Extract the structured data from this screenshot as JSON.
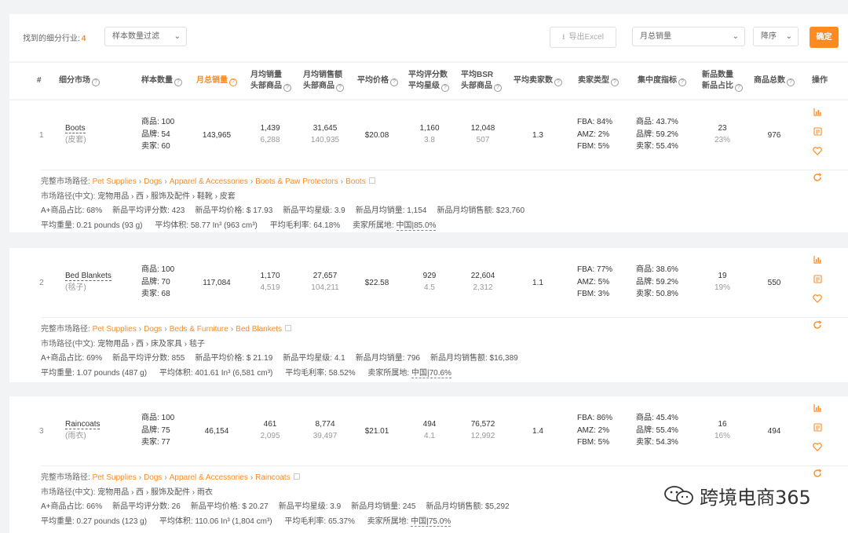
{
  "toolbar": {
    "found_label": "找到的细分行业:",
    "found_count": "4",
    "filter_placeholder": "样本数量过滤",
    "export_label": "导出Excel",
    "metric_value": "月总销量",
    "order_value": "降序",
    "confirm_label": "确定"
  },
  "header": {
    "idx": "#",
    "market": "细分市场",
    "sample": "样本数量",
    "monthly_total": "月总销量",
    "avg_sales_l1": "月均销量",
    "avg_sales_l2": "头部商品",
    "avg_revenue_l1": "月均销售额",
    "avg_revenue_l2": "头部商品",
    "avg_price": "平均价格",
    "reviews_l1": "平均评分数",
    "reviews_l2": "平均星级",
    "bsr_l1": "平均BSR",
    "bsr_l2": "头部商品",
    "sellers": "平均卖家数",
    "seller_type": "卖家类型",
    "concentration": "集中度指标",
    "new_l1": "新品数量",
    "new_l2": "新品占比",
    "total": "商品总数",
    "ops": "操作"
  },
  "rows": [
    {
      "idx": "1",
      "name": "Boots",
      "name_cn": "(皮套)",
      "sample": [
        "商品: 100",
        "品牌: 54",
        "卖家: 60"
      ],
      "monthly_total": "143,965",
      "avg_sales": "1,439",
      "avg_sales_head": "6,288",
      "avg_revenue": "31,645",
      "avg_revenue_head": "140,935",
      "avg_price": "$20.08",
      "reviews": "1,160",
      "stars": "3.8",
      "bsr": "12,048",
      "bsr_head": "507",
      "sellers": "1.3",
      "seller_type": [
        "FBA: 84%",
        "AMZ: 2%",
        "FBM: 5%"
      ],
      "concentration": [
        "商品: 43.7%",
        "品牌: 59.2%",
        "卖家: 55.4%"
      ],
      "new_count": "23",
      "new_ratio": "23%",
      "total": "976",
      "path_label": "完整市场路径:",
      "path": [
        "Pet Supplies",
        "Dogs",
        "Apparel & Accessories",
        "Boots & Paw Protectors",
        "Boots"
      ],
      "path_cn_label": "市场路径(中文):",
      "path_cn": "宠物用品 › 西 › 服饰及配件 › 鞋靴 › 皮套",
      "stats1": [
        "A+商品占比: 68%",
        "新品平均评分数: 423",
        "新品平均价格: $ 17.93",
        "新品平均星级: 3.9",
        "新品月均销量: 1,154",
        "新品月均销售额: $23,760"
      ],
      "stats2_weight": "平均重量: 0.21 pounds (93 g)",
      "stats2_volume": "平均体积: 58.77 In³ (963 cm³)",
      "stats2_margin": "平均毛利率: 64.18%",
      "stats2_origin_label": "卖家所属地:",
      "stats2_origin": "中国|85.0%"
    },
    {
      "idx": "2",
      "name": "Bed Blankets",
      "name_cn": "(毯子)",
      "sample": [
        "商品: 100",
        "品牌: 70",
        "卖家: 68"
      ],
      "monthly_total": "117,084",
      "avg_sales": "1,170",
      "avg_sales_head": "4,519",
      "avg_revenue": "27,657",
      "avg_revenue_head": "104,211",
      "avg_price": "$22.58",
      "reviews": "929",
      "stars": "4.5",
      "bsr": "22,604",
      "bsr_head": "2,312",
      "sellers": "1.1",
      "seller_type": [
        "FBA: 77%",
        "AMZ: 5%",
        "FBM: 3%"
      ],
      "concentration": [
        "商品: 38.6%",
        "品牌: 59.2%",
        "卖家: 50.8%"
      ],
      "new_count": "19",
      "new_ratio": "19%",
      "total": "550",
      "path_label": "完整市场路径:",
      "path": [
        "Pet Supplies",
        "Dogs",
        "Beds & Furniture",
        "Bed Blankets"
      ],
      "path_cn_label": "市场路径(中文):",
      "path_cn": "宠物用品 › 西 › 床及家具 › 毯子",
      "stats1": [
        "A+商品占比: 69%",
        "新品平均评分数: 855",
        "新品平均价格: $ 21.19",
        "新品平均星级: 4.1",
        "新品月均销量: 796",
        "新品月均销售额: $16,389"
      ],
      "stats2_weight": "平均重量: 1.07 pounds (487 g)",
      "stats2_volume": "平均体积: 401.61 In³ (6,581 cm³)",
      "stats2_margin": "平均毛利率: 58.52%",
      "stats2_origin_label": "卖家所属地:",
      "stats2_origin": "中国|70.6%"
    },
    {
      "idx": "3",
      "name": "Raincoats",
      "name_cn": "(雨衣)",
      "sample": [
        "商品: 100",
        "品牌: 75",
        "卖家: 77"
      ],
      "monthly_total": "46,154",
      "avg_sales": "461",
      "avg_sales_head": "2,095",
      "avg_revenue": "8,774",
      "avg_revenue_head": "39,497",
      "avg_price": "$21.01",
      "reviews": "494",
      "stars": "4.1",
      "bsr": "76,572",
      "bsr_head": "12,992",
      "sellers": "1.4",
      "seller_type": [
        "FBA: 86%",
        "AMZ: 2%",
        "FBM: 5%"
      ],
      "concentration": [
        "商品: 45.4%",
        "品牌: 55.4%",
        "卖家: 54.3%"
      ],
      "new_count": "16",
      "new_ratio": "16%",
      "total": "494",
      "path_label": "完整市场路径:",
      "path": [
        "Pet Supplies",
        "Dogs",
        "Apparel & Accessories",
        "Raincoats"
      ],
      "path_cn_label": "市场路径(中文):",
      "path_cn": "宠物用品 › 西 › 服饰及配件 › 雨衣",
      "stats1": [
        "A+商品占比: 66%",
        "新品平均评分数: 26",
        "新品平均价格: $ 20.27",
        "新品平均星级: 3.9",
        "新品月均销量: 245",
        "新品月均销售额: $5,292"
      ],
      "stats2_weight": "平均重量: 0.27 pounds (123 g)",
      "stats2_volume": "平均体积: 110.06 In³ (1,804 cm³)",
      "stats2_margin": "平均毛利率: 65.37%",
      "stats2_origin_label": "卖家所属地:",
      "stats2_origin": "中国|75.0%"
    }
  ],
  "watermark": "跨境电商365",
  "colors": {
    "accent": "#ff8a1f",
    "background": "#f2f3f5"
  }
}
